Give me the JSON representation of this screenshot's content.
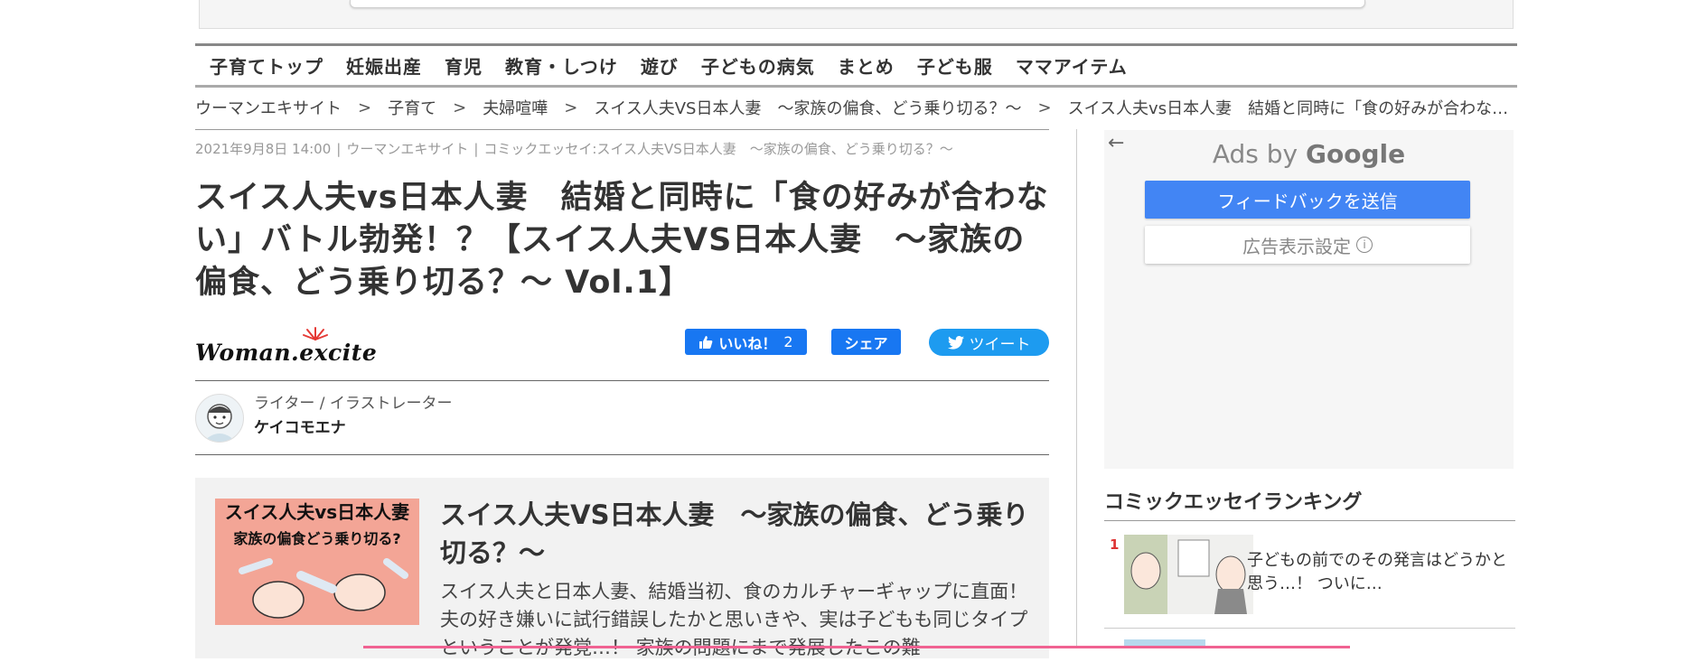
{
  "category_nav": {
    "items": [
      "子育てトップ",
      "妊娠出産",
      "育児",
      "教育・しつけ",
      "遊び",
      "子どもの病気",
      "まとめ",
      "子ども服",
      "ママアイテム"
    ]
  },
  "breadcrumb": {
    "separator": ">",
    "items": [
      "ウーマンエキサイト",
      "子育て",
      "夫婦喧嘩",
      "スイス人夫VS日本人妻　～家族の偏食、どう乗り切る？～",
      "スイス人夫vs日本人妻　結婚と同時に「食の好みが合わな…"
    ]
  },
  "article": {
    "date": "2021年9月8日 14:00",
    "source": "ウーマンエキサイト",
    "category": "コミックエッセイ:スイス人夫VS日本人妻　～家族の偏食、どう乗り切る？～",
    "title": "スイス人夫vs日本人妻　結婚と同時に「食の好みが合わない」バトル勃発！？【スイス人夫VS日本人妻　～家族の偏食、どう乗り切る？～ Vol.1】"
  },
  "logo": {
    "text": "Woman.excite",
    "icon": "woman-excite-logo"
  },
  "social": {
    "like_label": "いいね！",
    "like_count": "2",
    "share_label": "シェア",
    "tweet_label": "ツイート",
    "like_color": "#1877f2",
    "tweet_color": "#1d9bf0"
  },
  "author": {
    "role": "ライター / イラストレーター",
    "name": "ケイコモエナ"
  },
  "series": {
    "thumb_line1": "スイス人夫vs日本人妻",
    "thumb_line2": "家族の偏食どう乗り切る?",
    "title": "スイス人夫VS日本人妻　～家族の偏食、どう乗り切る？～",
    "description": "スイス人夫と日本人妻、結婚当初、食のカルチャーギャップに直面！ 夫の好き嫌いに試行錯誤したかと思いきや、実は子どもも同じタイプということが発覚…！ 家族の問題にまで発展したこの難"
  },
  "ads": {
    "back_icon": "arrow-left-icon",
    "label_prefix": "Ads by",
    "label_brand": "Google",
    "feedback_button": "フィードバックを送信",
    "settings_button": "広告表示設定",
    "settings_icon": "info-icon",
    "feedback_color": "#4285f4"
  },
  "ranking": {
    "heading": "コミックエッセイランキング",
    "items": [
      {
        "rank": "1",
        "text": "子どもの前でのその発言はどうかと思う…！ ついに…"
      }
    ]
  }
}
